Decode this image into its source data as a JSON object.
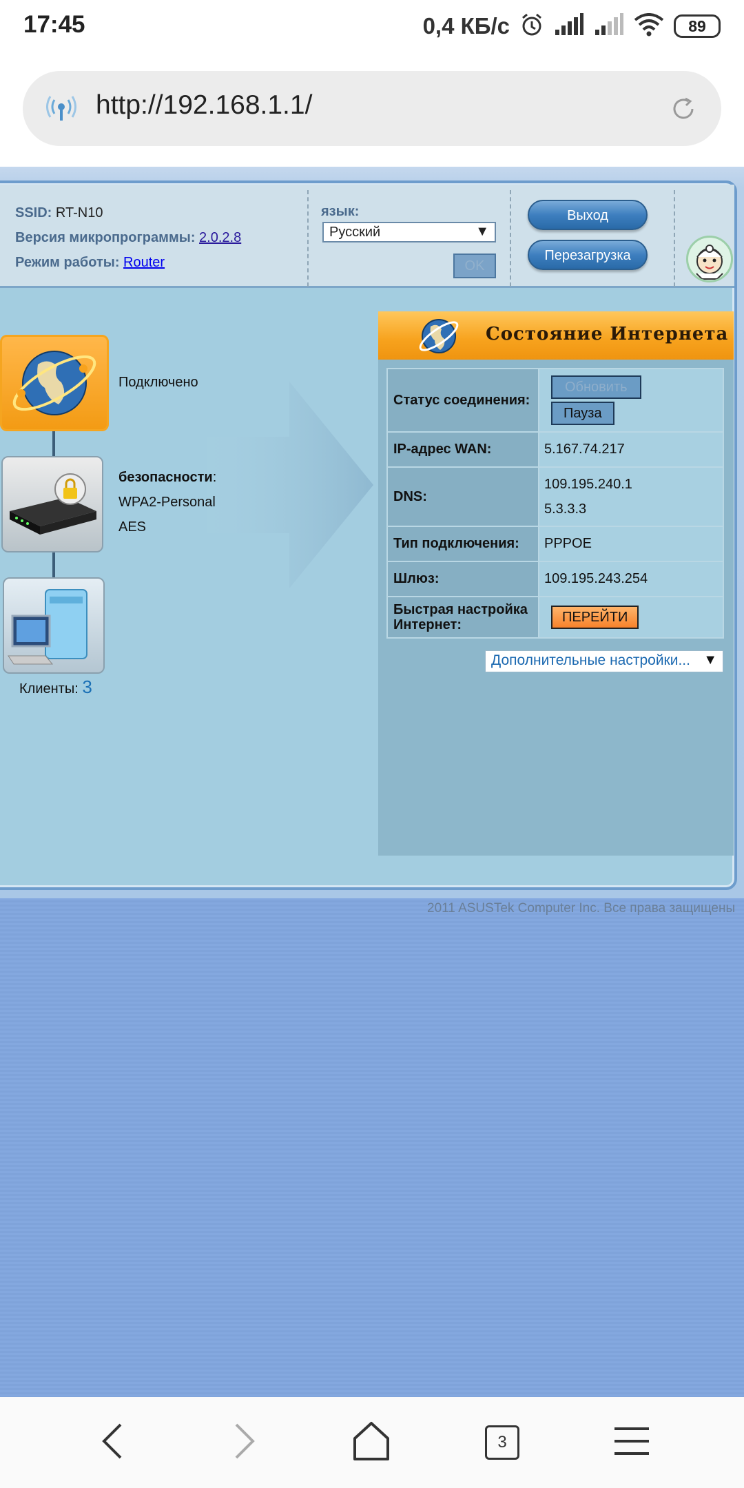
{
  "statusbar": {
    "time": "17:45",
    "speed": "0,4 КБ/с",
    "battery": "89"
  },
  "browser": {
    "url": "http://192.168.1.1/",
    "tabs_count": "3"
  },
  "router": {
    "ssid_label": "SSID:",
    "ssid_value": "RT-N10",
    "firmware_label": "Версия микропрограммы:",
    "firmware_value": "2.0.2.8",
    "mode_label": "Режим работы:",
    "mode_value": "Router",
    "language_label": "язык:",
    "language_value": "Русский",
    "ok_label": "OK",
    "logout_label": "Выход",
    "reboot_label": "Перезагрузка"
  },
  "topology": {
    "internet_status": "Подключено",
    "security_label": "безопасности",
    "security_colon": ":",
    "security_mode": "WPA2-Personal",
    "encryption": "AES",
    "clients_label": "Клиенты:",
    "clients_count": "3"
  },
  "panel": {
    "title": "Состояние Интернета",
    "rows": {
      "status_label": "Статус соединения:",
      "refresh_label": "Обновить",
      "pause_label": "Пауза",
      "wan_ip_label": "IP-адрес WAN:",
      "wan_ip_value": "5.167.74.217",
      "dns_label": "DNS:",
      "dns_primary": "109.195.240.1",
      "dns_secondary": "5.3.3.3",
      "conn_type_label": "Тип подключения:",
      "conn_type_value": "PPPOE",
      "gateway_label": "Шлюз:",
      "gateway_value": "109.195.243.254",
      "quick_setup_label": "Быстрая настройка Интернет:",
      "go_label": "ПЕРЕЙТИ"
    },
    "advanced_label": "Дополнительные настройки..."
  },
  "footer": {
    "copyright": "2011 ASUSTek Computer Inc. Все права защищены"
  },
  "colors": {
    "accent_orange": "#f7a21d",
    "panel_blue": "#8db7cb",
    "page_blue": "#84a8df"
  }
}
